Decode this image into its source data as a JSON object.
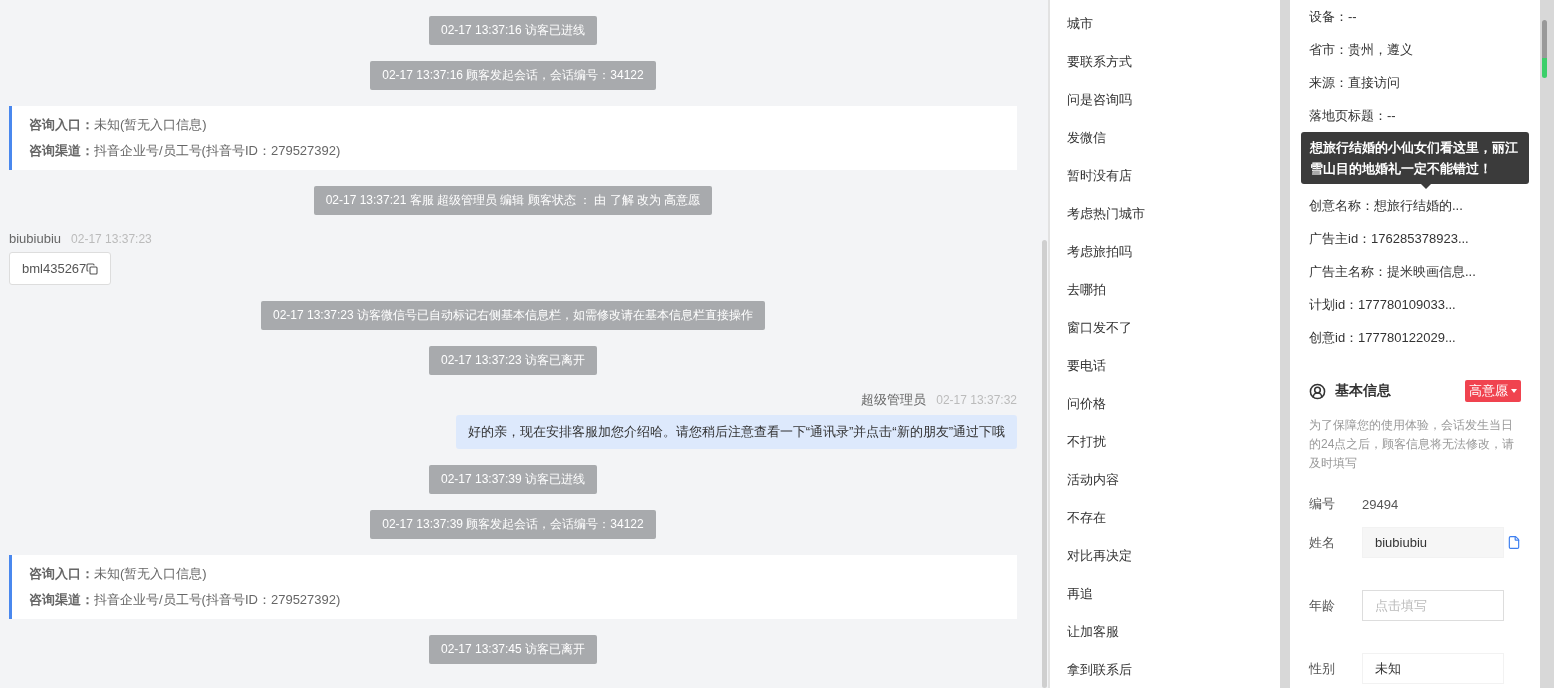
{
  "chat": {
    "messages": [
      {
        "kind": "notice",
        "text": "02-17 13:37:16 访客已进线"
      },
      {
        "kind": "notice",
        "text": "02-17 13:37:16 顾客发起会话，会话编号：34122"
      },
      {
        "kind": "entry",
        "lines": [
          {
            "label": "咨询入口：",
            "value": "未知(暂无入口信息)"
          },
          {
            "label": "咨询渠道：",
            "value": "抖音企业号/员工号(抖音号ID：279527392)"
          }
        ]
      },
      {
        "kind": "notice",
        "text": "02-17 13:37:21 客服 超级管理员 编辑 顾客状态 ： 由 了解 改为 高意愿"
      },
      {
        "kind": "visitor",
        "name": "biubiubiu",
        "time": "02-17 13:37:23",
        "text": "bml435267"
      },
      {
        "kind": "notice",
        "text": "02-17 13:37:23 访客微信号已自动标记右侧基本信息栏，如需修改请在基本信息栏直接操作"
      },
      {
        "kind": "notice",
        "text": "02-17 13:37:23 访客已离开"
      },
      {
        "kind": "agent",
        "name": "超级管理员",
        "time": "02-17 13:37:32",
        "text": "好的亲，现在安排客服加您介绍哈。请您稍后注意查看一下“通讯录”并点击“新的朋友”通过下哦"
      },
      {
        "kind": "notice",
        "text": "02-17 13:37:39 访客已进线"
      },
      {
        "kind": "notice",
        "text": "02-17 13:37:39 顾客发起会话，会话编号：34122"
      },
      {
        "kind": "entry",
        "lines": [
          {
            "label": "咨询入口：",
            "value": "未知(暂无入口信息)"
          },
          {
            "label": "咨询渠道：",
            "value": "抖音企业号/员工号(抖音号ID：279527392)"
          }
        ]
      },
      {
        "kind": "notice",
        "text": "02-17 13:37:45 访客已离开"
      }
    ]
  },
  "quick_replies": [
    "城市",
    "要联系方式",
    "问是咨询吗",
    "发微信",
    "暂时没有店",
    "考虑热门城市",
    "考虑旅拍吗",
    "去哪拍",
    "窗口发不了",
    "要电话",
    "问价格",
    "不打扰",
    "活动内容",
    "不存在",
    "对比再决定",
    "再追",
    "让加客服",
    "拿到联系后"
  ],
  "profile": {
    "fields_top": [
      "设备：--",
      "省市：贵州，遵义",
      "来源：直接访问",
      "落地页标题：--"
    ],
    "tooltip": "想旅行结婚的小仙女们看这里，丽江雪山目的地婚礼一定不能错过！",
    "fields_bottom": [
      "创意名称：想旅行结婚的...",
      "广告主id：176285378923...",
      "广告主名称：提米映画信息...",
      "计划id：177780109033...",
      "创意id：177780122029..."
    ],
    "basic_info": {
      "title": "基本信息",
      "tag": "高意愿",
      "note": "为了保障您的使用体验，会话发生当日的24点之后，顾客信息将无法修改，请及时填写",
      "rows": [
        {
          "kind": "text",
          "label": "编号",
          "value": "29494"
        },
        {
          "kind": "copy-input",
          "label": "姓名",
          "value": "biubiubiu"
        },
        {
          "kind": "input",
          "label": "年龄",
          "placeholder": "点击填写"
        },
        {
          "kind": "input",
          "label": "性别",
          "value": "未知"
        }
      ]
    }
  }
}
